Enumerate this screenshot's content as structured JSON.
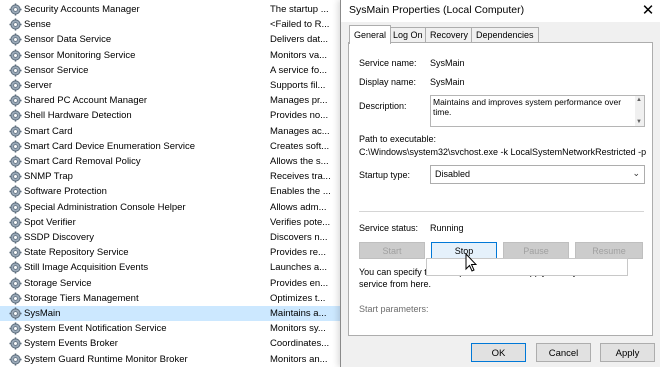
{
  "services": [
    {
      "name": "Security Accounts Manager",
      "desc": "The startup ..."
    },
    {
      "name": "Sense",
      "desc": "<Failed to R..."
    },
    {
      "name": "Sensor Data Service",
      "desc": "Delivers dat..."
    },
    {
      "name": "Sensor Monitoring Service",
      "desc": "Monitors va..."
    },
    {
      "name": "Sensor Service",
      "desc": "A service fo..."
    },
    {
      "name": "Server",
      "desc": "Supports fil..."
    },
    {
      "name": "Shared PC Account Manager",
      "desc": "Manages pr..."
    },
    {
      "name": "Shell Hardware Detection",
      "desc": "Provides no..."
    },
    {
      "name": "Smart Card",
      "desc": "Manages ac..."
    },
    {
      "name": "Smart Card Device Enumeration Service",
      "desc": "Creates soft..."
    },
    {
      "name": "Smart Card Removal Policy",
      "desc": "Allows the s..."
    },
    {
      "name": "SNMP Trap",
      "desc": "Receives tra..."
    },
    {
      "name": "Software Protection",
      "desc": "Enables the ..."
    },
    {
      "name": "Special Administration Console Helper",
      "desc": "Allows adm..."
    },
    {
      "name": "Spot Verifier",
      "desc": "Verifies pote..."
    },
    {
      "name": "SSDP Discovery",
      "desc": "Discovers n..."
    },
    {
      "name": "State Repository Service",
      "desc": "Provides re..."
    },
    {
      "name": "Still Image Acquisition Events",
      "desc": "Launches a..."
    },
    {
      "name": "Storage Service",
      "desc": "Provides en..."
    },
    {
      "name": "Storage Tiers Management",
      "desc": "Optimizes t..."
    },
    {
      "name": "SysMain",
      "desc": "Maintains a..."
    },
    {
      "name": "System Event Notification Service",
      "desc": "Monitors sy..."
    },
    {
      "name": "System Events Broker",
      "desc": "Coordinates..."
    },
    {
      "name": "System Guard Runtime Monitor Broker",
      "desc": "Monitors an..."
    }
  ],
  "selected_service": "SysMain",
  "dialog": {
    "title": "SysMain Properties (Local Computer)",
    "close": "✕",
    "tabs": [
      "General",
      "Log On",
      "Recovery",
      "Dependencies"
    ],
    "active_tab": "General",
    "service_name_label": "Service name:",
    "service_name": "SysMain",
    "display_name_label": "Display name:",
    "display_name": "SysMain",
    "description_label": "Description:",
    "description": "Maintains and improves system performance over time.",
    "path_label": "Path to executable:",
    "path": "C:\\Windows\\system32\\svchost.exe -k LocalSystemNetworkRestricted -p",
    "startup_type_label": "Startup type:",
    "startup_type": "Disabled",
    "status_label": "Service status:",
    "status": "Running",
    "buttons": {
      "start": "Start",
      "stop": "Stop",
      "pause": "Pause",
      "resume": "Resume"
    },
    "params_hint": "You can specify the start parameters that apply when you start the service from here.",
    "params_label": "Start parameters:",
    "params_value": "",
    "ok": "OK",
    "cancel": "Cancel",
    "apply": "Apply"
  },
  "colors": {
    "selected_row": "#cce8ff",
    "accent": "#0078d7"
  }
}
